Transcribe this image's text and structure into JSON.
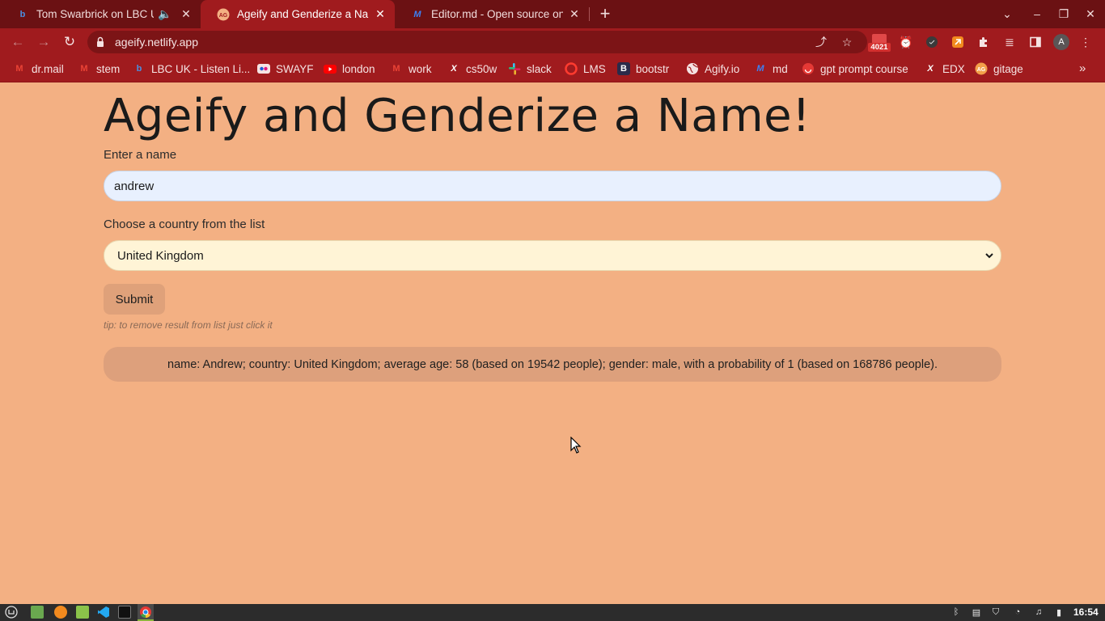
{
  "browser": {
    "tabs": [
      {
        "title": "Tom Swarbrick on LBC UK",
        "active": false
      },
      {
        "title": "Ageify and Genderize a Name",
        "active": true
      },
      {
        "title": "Editor.md - Open source onlin",
        "active": false
      }
    ],
    "url": "ageify.netlify.app",
    "mail_badge_count": "4021",
    "avatar_letter": "A",
    "bookmarks": [
      {
        "label": "dr.mail",
        "icon": "gmail-icon"
      },
      {
        "label": "stem",
        "icon": "gmail-icon"
      },
      {
        "label": "LBC UK - Listen Li...",
        "icon": "lbc-icon"
      },
      {
        "label": "SWAYF",
        "icon": "flickr-icon"
      },
      {
        "label": "london",
        "icon": "youtube-icon"
      },
      {
        "label": "work",
        "icon": "gmail-icon"
      },
      {
        "label": "cs50w",
        "icon": "edx-icon"
      },
      {
        "label": "slack",
        "icon": "slack-icon"
      },
      {
        "label": "LMS",
        "icon": "opera-icon"
      },
      {
        "label": "bootstr",
        "icon": "bootstrap-icon"
      },
      {
        "label": "Agify.io",
        "icon": "globe-icon"
      },
      {
        "label": "md",
        "icon": "markdown-icon"
      },
      {
        "label": "gpt prompt course",
        "icon": "smile-icon"
      },
      {
        "label": "EDX",
        "icon": "edx-icon"
      },
      {
        "label": "gitage",
        "icon": "gitage-icon"
      }
    ]
  },
  "page": {
    "heading": "Ageify and Genderize a Name!",
    "name_label": "Enter a name",
    "name_value": "andrew",
    "country_label": "Choose a country from the list",
    "country_selected": "United Kingdom",
    "submit_label": "Submit",
    "tip": "tip: to remove result from list just click it",
    "result": "name: Andrew; country: United Kingdom; average age: 58 (based on 19542 people); gender: male, with a probability of 1 (based on 168786 people)."
  },
  "taskbar": {
    "clock": "16:54"
  },
  "colors": {
    "page_bg": "#f3b083",
    "chrome_dark": "#6b1113",
    "chrome": "#a01b1e",
    "input_bg": "#e8f0fe",
    "select_bg": "#fff4d6",
    "button_bg": "#dfa17a",
    "result_bg": "#dda07c"
  }
}
